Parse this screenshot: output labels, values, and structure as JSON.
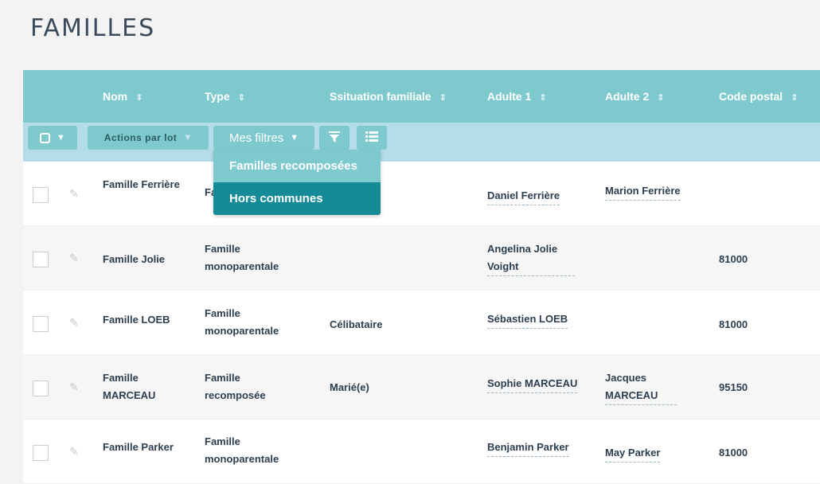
{
  "page": {
    "title": "FAMILLES"
  },
  "columns": [
    {
      "label": "Nom"
    },
    {
      "label": "Type"
    },
    {
      "label": "Ssituation familiale"
    },
    {
      "label": "Adulte 1"
    },
    {
      "label": "Adulte 2"
    },
    {
      "label": "Code postal"
    }
  ],
  "toolbar": {
    "batch_label": "Actions par lot",
    "filters_label": "Mes filtres"
  },
  "filters_menu": [
    "Familles recomposées",
    "Hors communes"
  ],
  "rows": [
    {
      "nom": "Famille Ferrière",
      "type": "Fa",
      "situation": "",
      "adulte1": "Daniel Ferrière",
      "adulte2": "Marion Ferrière",
      "cp": ""
    },
    {
      "nom": "Famille Jolie",
      "type": "Famille monoparentale",
      "situation": "",
      "adulte1": "Angelina Jolie Voight",
      "adulte2": "",
      "cp": "81000"
    },
    {
      "nom": "Famille LOEB",
      "type": "Famille monoparentale",
      "situation": "Célibataire",
      "adulte1": "Sébastien LOEB",
      "adulte2": "",
      "cp": "81000"
    },
    {
      "nom": "Famille MARCEAU",
      "type": "Famille recomposée",
      "situation": "Marié(e)",
      "adulte1": "Sophie MARCEAU",
      "adulte2": "Jacques MARCEAU",
      "cp": "95150"
    },
    {
      "nom": "Famille Parker",
      "type": "Famille monoparentale",
      "situation": "",
      "adulte1": "Benjamin Parker",
      "adulte2": "May Parker",
      "cp": "81000"
    }
  ],
  "colors": {
    "header": "#7ec9ce",
    "toolbar": "#b4dce9",
    "dropdown_item": "#7ec9ce",
    "dropdown_item_active": "#158b98"
  }
}
